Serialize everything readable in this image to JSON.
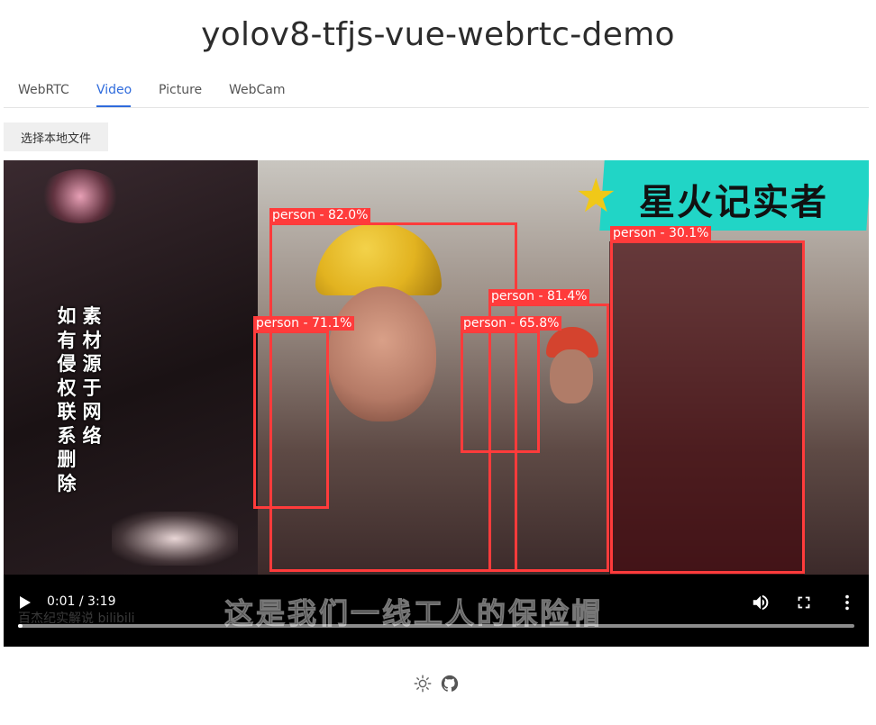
{
  "app": {
    "title": "yolov8-tfjs-vue-webrtc-demo"
  },
  "tabs": [
    {
      "label": "WebRTC"
    },
    {
      "label": "Video"
    },
    {
      "label": "Picture"
    },
    {
      "label": "WebCam"
    }
  ],
  "active_tab": "Video",
  "file_button": {
    "label": "选择本地文件"
  },
  "video": {
    "overlay_badge": "星火记实者",
    "vertical_caption": [
      "素材源于网络",
      "如有侵权联系删除"
    ],
    "subtitle": "这是我们一线工人的保险帽",
    "watermark": "百杰纪实解说 bilibili",
    "current_time": "0:01",
    "duration": "3:19",
    "time_display": "0:01 / 3:19",
    "progress": 0.005,
    "detections": [
      {
        "label": "person - 82.0%"
      },
      {
        "label": "person - 71.1%"
      },
      {
        "label": "person - 81.4%"
      },
      {
        "label": "person - 65.8%"
      },
      {
        "label": "person - 30.1%"
      }
    ]
  },
  "icons": {
    "play": "play-icon",
    "volume": "volume-icon",
    "fullscreen": "fullscreen-icon",
    "more": "more-vertical-icon",
    "theme": "sun-icon",
    "github": "github-icon"
  },
  "colors": {
    "accent": "#2f6bdc",
    "detection": "#ff3b3b",
    "badge": "#21d5c6"
  }
}
